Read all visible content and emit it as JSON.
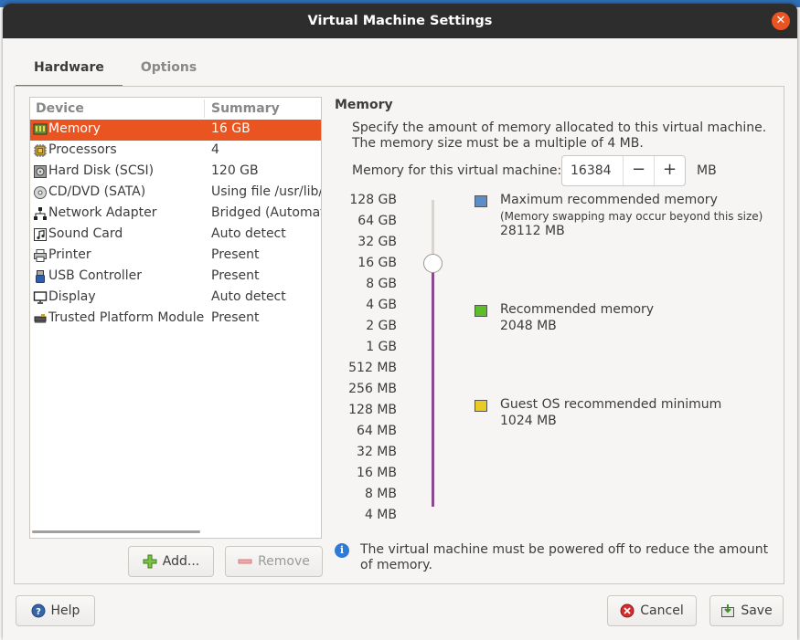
{
  "dialog": {
    "title": "Virtual Machine Settings"
  },
  "tabs": [
    {
      "label": "Hardware",
      "active": true
    },
    {
      "label": "Options",
      "active": false
    }
  ],
  "device_list": {
    "header_device": "Device",
    "header_summary": "Summary",
    "items": [
      {
        "name": "Memory",
        "summary": "16 GB",
        "icon": "memory-icon",
        "selected": true
      },
      {
        "name": "Processors",
        "summary": "4",
        "icon": "processor-icon"
      },
      {
        "name": "Hard Disk (SCSI)",
        "summary": "120 GB",
        "icon": "hard-disk-icon"
      },
      {
        "name": "CD/DVD (SATA)",
        "summary": "Using file /usr/lib/vmware",
        "icon": "cd-dvd-icon"
      },
      {
        "name": "Network Adapter",
        "summary": "Bridged (Automatic)",
        "icon": "network-icon"
      },
      {
        "name": "Sound Card",
        "summary": "Auto detect",
        "icon": "sound-card-icon"
      },
      {
        "name": "Printer",
        "summary": "Present",
        "icon": "printer-icon"
      },
      {
        "name": "USB Controller",
        "summary": "Present",
        "icon": "usb-icon"
      },
      {
        "name": "Display",
        "summary": "Auto detect",
        "icon": "display-icon"
      },
      {
        "name": "Trusted Platform Module",
        "summary": "Present",
        "icon": "tpm-icon"
      }
    ]
  },
  "buttons": {
    "add": "Add...",
    "remove": "Remove",
    "help": "Help",
    "cancel": "Cancel",
    "save": "Save"
  },
  "memory": {
    "title": "Memory",
    "description": "Specify the amount of memory allocated to this virtual machine. The memory size must be a multiple of 4 MB.",
    "field_label": "Memory for this virtual machine:",
    "value": "16384",
    "minus": "−",
    "plus": "+",
    "unit": "MB",
    "scale": [
      "128 GB",
      "64 GB",
      "32 GB",
      "16 GB",
      "8 GB",
      "4 GB",
      "2 GB",
      "1 GB",
      "512 MB",
      "256 MB",
      "128 MB",
      "64 MB",
      "32 MB",
      "16 MB",
      "8 MB",
      "4 MB"
    ],
    "slider_selected": "16 GB",
    "legend": [
      {
        "title": "Maximum recommended memory",
        "note": "(Memory swapping may occur beyond this size)",
        "value": "28112 MB",
        "color": "#5b8dc9"
      },
      {
        "title": "Recommended memory",
        "note": "",
        "value": "2048 MB",
        "color": "#5cbf2a"
      },
      {
        "title": "Guest OS recommended minimum",
        "note": "",
        "value": "1024 MB",
        "color": "#e8cc24"
      }
    ],
    "info": "The virtual machine must be powered off to reduce the amount of memory."
  },
  "colors": {
    "accent": "#e95420",
    "titlebar": "#2d2d2d",
    "slider_fill": "#8a4a8f"
  }
}
